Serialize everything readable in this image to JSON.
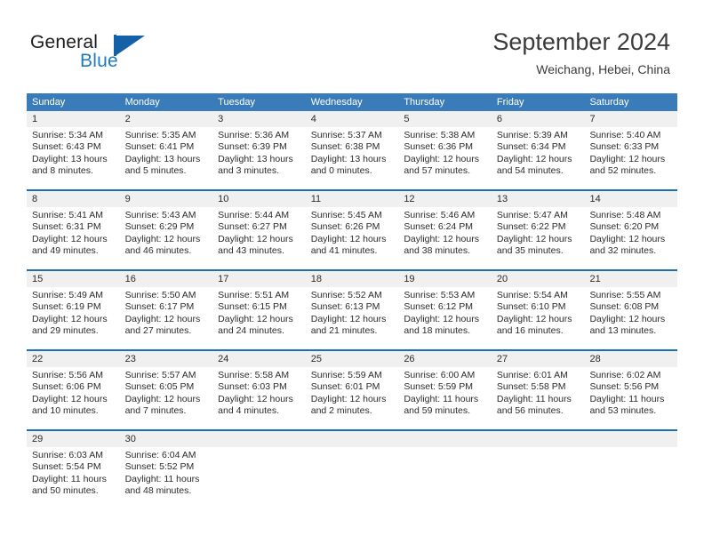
{
  "brand": {
    "word_one": "General",
    "word_two": "Blue",
    "logo_icon": "triangle-flag-icon",
    "color_blue": "#1f7ac4",
    "color_dark_blue": "#1461a8"
  },
  "header": {
    "month_title": "September 2024",
    "location": "Weichang, Hebei, China"
  },
  "theme": {
    "header_row_bg": "#3a7cba",
    "week_separator": "#1e6fb0",
    "daynum_bg": "#f0f0f0",
    "text": "#2b2b2b"
  },
  "calendar": {
    "weekday_headers": [
      "Sunday",
      "Monday",
      "Tuesday",
      "Wednesday",
      "Thursday",
      "Friday",
      "Saturday"
    ],
    "weeks": [
      {
        "days": [
          {
            "num": "1",
            "sunrise": "Sunrise: 5:34 AM",
            "sunset": "Sunset: 6:43 PM",
            "daylight": "Daylight: 13 hours and 8 minutes."
          },
          {
            "num": "2",
            "sunrise": "Sunrise: 5:35 AM",
            "sunset": "Sunset: 6:41 PM",
            "daylight": "Daylight: 13 hours and 5 minutes."
          },
          {
            "num": "3",
            "sunrise": "Sunrise: 5:36 AM",
            "sunset": "Sunset: 6:39 PM",
            "daylight": "Daylight: 13 hours and 3 minutes."
          },
          {
            "num": "4",
            "sunrise": "Sunrise: 5:37 AM",
            "sunset": "Sunset: 6:38 PM",
            "daylight": "Daylight: 13 hours and 0 minutes."
          },
          {
            "num": "5",
            "sunrise": "Sunrise: 5:38 AM",
            "sunset": "Sunset: 6:36 PM",
            "daylight": "Daylight: 12 hours and 57 minutes."
          },
          {
            "num": "6",
            "sunrise": "Sunrise: 5:39 AM",
            "sunset": "Sunset: 6:34 PM",
            "daylight": "Daylight: 12 hours and 54 minutes."
          },
          {
            "num": "7",
            "sunrise": "Sunrise: 5:40 AM",
            "sunset": "Sunset: 6:33 PM",
            "daylight": "Daylight: 12 hours and 52 minutes."
          }
        ]
      },
      {
        "days": [
          {
            "num": "8",
            "sunrise": "Sunrise: 5:41 AM",
            "sunset": "Sunset: 6:31 PM",
            "daylight": "Daylight: 12 hours and 49 minutes."
          },
          {
            "num": "9",
            "sunrise": "Sunrise: 5:43 AM",
            "sunset": "Sunset: 6:29 PM",
            "daylight": "Daylight: 12 hours and 46 minutes."
          },
          {
            "num": "10",
            "sunrise": "Sunrise: 5:44 AM",
            "sunset": "Sunset: 6:27 PM",
            "daylight": "Daylight: 12 hours and 43 minutes."
          },
          {
            "num": "11",
            "sunrise": "Sunrise: 5:45 AM",
            "sunset": "Sunset: 6:26 PM",
            "daylight": "Daylight: 12 hours and 41 minutes."
          },
          {
            "num": "12",
            "sunrise": "Sunrise: 5:46 AM",
            "sunset": "Sunset: 6:24 PM",
            "daylight": "Daylight: 12 hours and 38 minutes."
          },
          {
            "num": "13",
            "sunrise": "Sunrise: 5:47 AM",
            "sunset": "Sunset: 6:22 PM",
            "daylight": "Daylight: 12 hours and 35 minutes."
          },
          {
            "num": "14",
            "sunrise": "Sunrise: 5:48 AM",
            "sunset": "Sunset: 6:20 PM",
            "daylight": "Daylight: 12 hours and 32 minutes."
          }
        ]
      },
      {
        "days": [
          {
            "num": "15",
            "sunrise": "Sunrise: 5:49 AM",
            "sunset": "Sunset: 6:19 PM",
            "daylight": "Daylight: 12 hours and 29 minutes."
          },
          {
            "num": "16",
            "sunrise": "Sunrise: 5:50 AM",
            "sunset": "Sunset: 6:17 PM",
            "daylight": "Daylight: 12 hours and 27 minutes."
          },
          {
            "num": "17",
            "sunrise": "Sunrise: 5:51 AM",
            "sunset": "Sunset: 6:15 PM",
            "daylight": "Daylight: 12 hours and 24 minutes."
          },
          {
            "num": "18",
            "sunrise": "Sunrise: 5:52 AM",
            "sunset": "Sunset: 6:13 PM",
            "daylight": "Daylight: 12 hours and 21 minutes."
          },
          {
            "num": "19",
            "sunrise": "Sunrise: 5:53 AM",
            "sunset": "Sunset: 6:12 PM",
            "daylight": "Daylight: 12 hours and 18 minutes."
          },
          {
            "num": "20",
            "sunrise": "Sunrise: 5:54 AM",
            "sunset": "Sunset: 6:10 PM",
            "daylight": "Daylight: 12 hours and 16 minutes."
          },
          {
            "num": "21",
            "sunrise": "Sunrise: 5:55 AM",
            "sunset": "Sunset: 6:08 PM",
            "daylight": "Daylight: 12 hours and 13 minutes."
          }
        ]
      },
      {
        "days": [
          {
            "num": "22",
            "sunrise": "Sunrise: 5:56 AM",
            "sunset": "Sunset: 6:06 PM",
            "daylight": "Daylight: 12 hours and 10 minutes."
          },
          {
            "num": "23",
            "sunrise": "Sunrise: 5:57 AM",
            "sunset": "Sunset: 6:05 PM",
            "daylight": "Daylight: 12 hours and 7 minutes."
          },
          {
            "num": "24",
            "sunrise": "Sunrise: 5:58 AM",
            "sunset": "Sunset: 6:03 PM",
            "daylight": "Daylight: 12 hours and 4 minutes."
          },
          {
            "num": "25",
            "sunrise": "Sunrise: 5:59 AM",
            "sunset": "Sunset: 6:01 PM",
            "daylight": "Daylight: 12 hours and 2 minutes."
          },
          {
            "num": "26",
            "sunrise": "Sunrise: 6:00 AM",
            "sunset": "Sunset: 5:59 PM",
            "daylight": "Daylight: 11 hours and 59 minutes."
          },
          {
            "num": "27",
            "sunrise": "Sunrise: 6:01 AM",
            "sunset": "Sunset: 5:58 PM",
            "daylight": "Daylight: 11 hours and 56 minutes."
          },
          {
            "num": "28",
            "sunrise": "Sunrise: 6:02 AM",
            "sunset": "Sunset: 5:56 PM",
            "daylight": "Daylight: 11 hours and 53 minutes."
          }
        ]
      },
      {
        "days": [
          {
            "num": "29",
            "sunrise": "Sunrise: 6:03 AM",
            "sunset": "Sunset: 5:54 PM",
            "daylight": "Daylight: 11 hours and 50 minutes."
          },
          {
            "num": "30",
            "sunrise": "Sunrise: 6:04 AM",
            "sunset": "Sunset: 5:52 PM",
            "daylight": "Daylight: 11 hours and 48 minutes."
          },
          {
            "num": "",
            "sunrise": "",
            "sunset": "",
            "daylight": ""
          },
          {
            "num": "",
            "sunrise": "",
            "sunset": "",
            "daylight": ""
          },
          {
            "num": "",
            "sunrise": "",
            "sunset": "",
            "daylight": ""
          },
          {
            "num": "",
            "sunrise": "",
            "sunset": "",
            "daylight": ""
          },
          {
            "num": "",
            "sunrise": "",
            "sunset": "",
            "daylight": ""
          }
        ]
      }
    ]
  }
}
